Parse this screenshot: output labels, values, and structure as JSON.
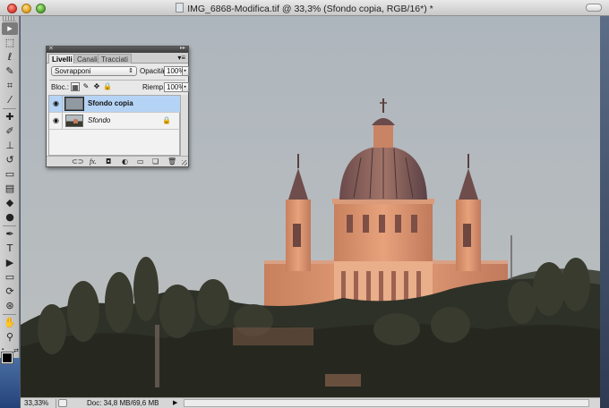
{
  "window": {
    "title": "IMG_6868-Modifica.tif @ 33,3% (Sfondo copia, RGB/16*) *"
  },
  "toolbar": {
    "tools": [
      {
        "name": "move-tool",
        "glyph": "▸"
      },
      {
        "name": "marquee-tool",
        "glyph": "⬚"
      },
      {
        "name": "lasso-tool",
        "glyph": "ℓ"
      },
      {
        "name": "quick-selection-tool",
        "glyph": "✎"
      },
      {
        "name": "crop-tool",
        "glyph": "⌗"
      },
      {
        "name": "eyedropper-tool",
        "glyph": "⁄"
      },
      {
        "name": "healing-brush-tool",
        "glyph": "✚"
      },
      {
        "name": "brush-tool",
        "glyph": "✐"
      },
      {
        "name": "clone-stamp-tool",
        "glyph": "⊥"
      },
      {
        "name": "history-brush-tool",
        "glyph": "↺"
      },
      {
        "name": "eraser-tool",
        "glyph": "▭"
      },
      {
        "name": "gradient-tool",
        "glyph": "▤"
      },
      {
        "name": "blur-tool",
        "glyph": "◆"
      },
      {
        "name": "dodge-tool",
        "glyph": "●"
      },
      {
        "name": "pen-tool",
        "glyph": "✒"
      },
      {
        "name": "type-tool",
        "glyph": "T"
      },
      {
        "name": "path-selection-tool",
        "glyph": "▶"
      },
      {
        "name": "shape-tool",
        "glyph": "▭"
      },
      {
        "name": "3d-rotate-tool",
        "glyph": "⟳"
      },
      {
        "name": "3d-orbit-tool",
        "glyph": "⊛"
      },
      {
        "name": "hand-tool",
        "glyph": "✋"
      },
      {
        "name": "zoom-tool",
        "glyph": "⚲"
      }
    ],
    "quick_mask_glyph": "◙"
  },
  "layers_panel": {
    "tabs": [
      "Livelli",
      "Canali",
      "Tracciati"
    ],
    "active_tab": "Livelli",
    "blend_mode": "Sovrapponi",
    "opacity_label": "Opacità:",
    "opacity_value": "100%",
    "lock_label": "Bloc.:",
    "fill_label": "Riemp.:",
    "fill_value": "100%",
    "layers": [
      {
        "name": "Sfondo copia",
        "selected": true,
        "locked": false
      },
      {
        "name": "Sfondo",
        "selected": false,
        "locked": true
      }
    ],
    "footer_buttons": [
      {
        "name": "link-layers-button",
        "glyph": "⊂⊃"
      },
      {
        "name": "layer-style-button",
        "glyph": "fx."
      },
      {
        "name": "add-mask-button",
        "glyph": "◘"
      },
      {
        "name": "adjustment-layer-button",
        "glyph": "◐"
      },
      {
        "name": "new-group-button",
        "glyph": "▭"
      },
      {
        "name": "new-layer-button",
        "glyph": "❏"
      },
      {
        "name": "delete-layer-button",
        "glyph": "🗑"
      }
    ]
  },
  "status_bar": {
    "zoom": "33,33%",
    "doc_info": "Doc: 34,8 MB/69,6 MB"
  },
  "colors": {
    "foreground": "#000000",
    "background": "#ffffff",
    "selected_layer": "#b5d3f5"
  }
}
